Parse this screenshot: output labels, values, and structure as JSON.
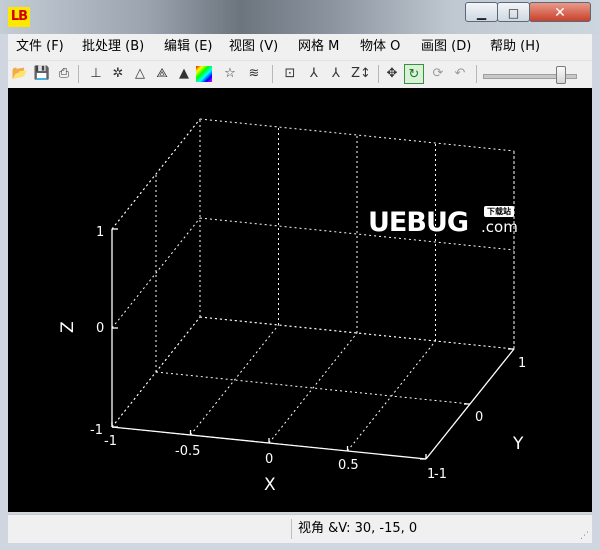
{
  "window": {
    "logo_text": "LB",
    "min_glyph": "▁",
    "max_glyph": "□",
    "close_glyph": "✕"
  },
  "menu": {
    "items": [
      {
        "label": "文件 (F)"
      },
      {
        "label": "批处理 (B)"
      },
      {
        "label": "编辑 (E)"
      },
      {
        "label": "视图 (V)"
      },
      {
        "label": "网格 M"
      },
      {
        "label": "物体 O"
      },
      {
        "label": "画图 (D)"
      },
      {
        "label": "帮助 (H)"
      }
    ]
  },
  "toolbar": {
    "icons": [
      {
        "name": "open-folder-icon",
        "glyph": "📂"
      },
      {
        "name": "save-disk-icon",
        "glyph": "💾"
      },
      {
        "name": "print-icon",
        "glyph": "⎙"
      },
      {
        "name": "axes-icon",
        "glyph": "⊥"
      },
      {
        "name": "light-icon",
        "glyph": "✲"
      },
      {
        "name": "mesh-icon",
        "glyph": "△"
      },
      {
        "name": "wireframe-icon",
        "glyph": "⟁"
      },
      {
        "name": "solid-cone-icon",
        "glyph": "▲"
      },
      {
        "name": "color-map-icon",
        "glyph": "■"
      },
      {
        "name": "star-icon",
        "glyph": "☆"
      },
      {
        "name": "contour-icon",
        "glyph": "≋"
      },
      {
        "name": "box-icon",
        "glyph": "⊡"
      },
      {
        "name": "xyz-axes-icon",
        "glyph": "⅄"
      },
      {
        "name": "xz-axes-icon",
        "glyph": "⅄"
      },
      {
        "name": "z-scale-icon",
        "glyph": "Z↕"
      },
      {
        "name": "move-icon",
        "glyph": "✥"
      },
      {
        "name": "rotate-icon",
        "glyph": "↻"
      },
      {
        "name": "rotate-light-icon",
        "glyph": "⟳"
      },
      {
        "name": "undo-rotate-icon",
        "glyph": "↶"
      }
    ],
    "zoom_level": 0.78
  },
  "plot": {
    "z_axis_label": "Z",
    "x_axis_label": "X",
    "y_axis_label": "Y",
    "z_ticks": [
      "1",
      "0",
      "-1"
    ],
    "x_ticks": [
      "-1",
      "-0.5",
      "0",
      "0.5",
      "1"
    ],
    "y_ticks": [
      "-1",
      "0",
      "1"
    ],
    "z_range": [
      -1,
      1
    ],
    "x_range": [
      -1,
      1
    ],
    "y_range": [
      -1,
      1
    ],
    "grid": true,
    "colors": {
      "background": "#000000",
      "lines": "#ffffff"
    }
  },
  "watermark": {
    "main": "UEBUG",
    "domain": ".com",
    "tag": "下载站"
  },
  "status": {
    "view_angle": "视角 &V: 30, -15, 0"
  }
}
